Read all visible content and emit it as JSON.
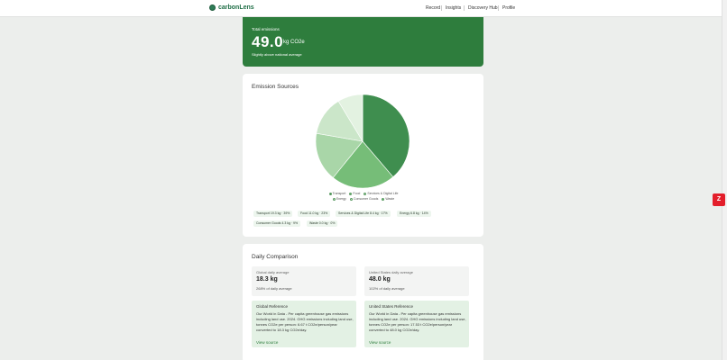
{
  "app": {
    "brand": "carbonLens",
    "nav": [
      "Record",
      "Insights",
      "Discovery Hub",
      "Profile"
    ],
    "side_badge": "Z"
  },
  "hero": {
    "label": "Total emissions",
    "value": "49.0",
    "unit": "kg CO2e",
    "note": "Slightly above national average"
  },
  "sources": {
    "title": "Emission Sources",
    "legend": [
      {
        "name": "Transport",
        "color": "#3f8e4f"
      },
      {
        "name": "Food",
        "color": "#76bd78"
      },
      {
        "name": "Services & Digital Life",
        "color": "#a9d6a8"
      },
      {
        "name": "Energy",
        "color": "#cbe6c9"
      },
      {
        "name": "Consumer Goods",
        "color": "#e3f2e1"
      },
      {
        "name": "Waste",
        "color": "#67c777"
      }
    ],
    "chips": [
      "Transport 19.3 kg · 39%",
      "Food 11.0 kg · 23%",
      "Services & Digital Life 8.4 kg · 17%",
      "Energy 6.8 kg · 14%",
      "Consumer Goods 4.3 kg · 9%",
      "Waste 0.0 kg · 0%"
    ]
  },
  "chart_data": {
    "type": "pie",
    "categories": [
      "Transport",
      "Food",
      "Services & Digital Life",
      "Energy",
      "Consumer Goods",
      "Waste"
    ],
    "values": [
      19.3,
      11.0,
      8.4,
      6.8,
      4.3,
      0.0
    ],
    "percent": [
      39,
      23,
      17,
      14,
      9,
      0
    ],
    "colors": [
      "#3f8e4f",
      "#76bd78",
      "#a9d6a8",
      "#cbe6c9",
      "#e3f2e1",
      "#67c777"
    ],
    "title": "Emission Sources"
  },
  "daily": {
    "title": "Daily Comparison",
    "global": {
      "heading": "Global daily average",
      "value": "18.3 kg",
      "percent": "268% of daily average"
    },
    "us": {
      "heading": "United States daily average",
      "value": "48.0 kg",
      "percent": "102% of daily average"
    },
    "global_ref": {
      "heading": "Global Reference",
      "text": "Our World in Data - Per capita greenhouse gas emissions including land use. 2024. GHG emissions including land use, tonnes CO2e per person: 6.67 t CO2e/person/year converted to 18.3 kg CO2e/day.",
      "source": "View source"
    },
    "us_ref": {
      "heading": "United States Reference",
      "text": "Our World in Data - Per capita greenhouse gas emissions including land use. 2024. GHG emissions including land use, tonnes CO2e per person: 17.53 t CO2e/person/year converted to 48.0 kg CO2e/day.",
      "source": "View source"
    }
  }
}
